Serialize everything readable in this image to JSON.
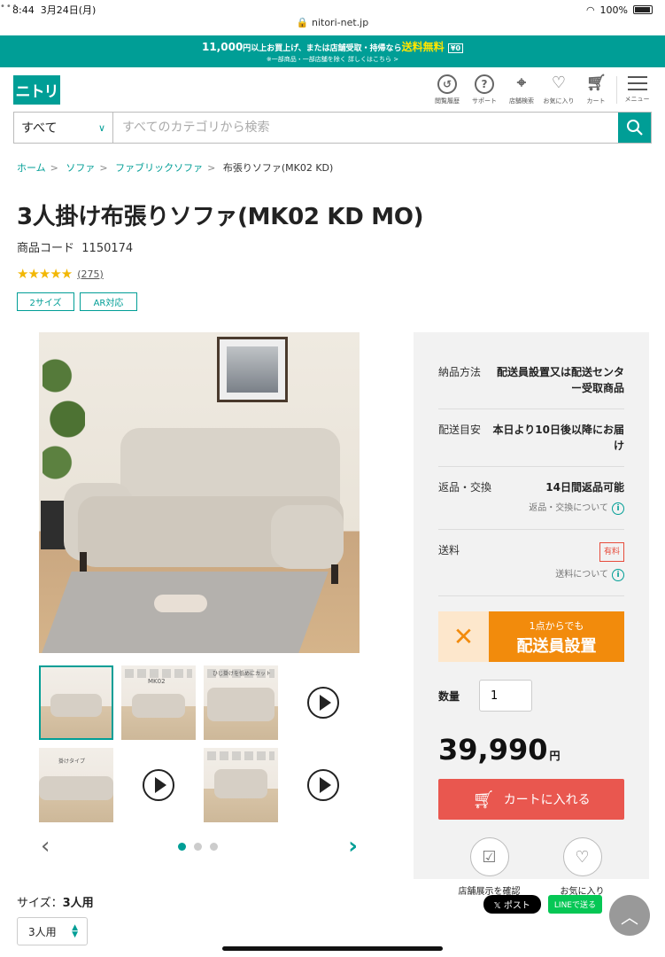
{
  "status": {
    "time": "8:44",
    "date": "3月24日(月)",
    "url": "nitori-net.jp",
    "battery": "100%"
  },
  "banner": {
    "line1_a": "11,000",
    "line1_b": "円以上お買上げ、または店舗受取・持帰なら",
    "line1_c": "送料無料",
    "line2": "※一部商品・一部店舗を除く 詳しくはこちら >"
  },
  "header": {
    "logo": "ニトリ",
    "icons": [
      {
        "label": "閲覧履歴",
        "icon": "history-icon"
      },
      {
        "label": "サポート",
        "icon": "help-icon"
      },
      {
        "label": "店舗検索",
        "icon": "location-pin-icon"
      },
      {
        "label": "お気に入り",
        "icon": "heart-icon",
        "count": "0"
      },
      {
        "label": "カート",
        "icon": "cart-icon",
        "count": "0"
      }
    ],
    "menu_label": "メニュー"
  },
  "search": {
    "category": "すべて",
    "placeholder": "すべてのカテゴリから検索"
  },
  "breadcrumb": [
    "ホーム",
    "ソファ",
    "ファブリックソファ",
    "布張りソファ(MK02 KD)"
  ],
  "product": {
    "title": "3人掛け布張りソファ(MK02 KD MO)",
    "code_label": "商品コード",
    "code": "1150174",
    "stars": "★★★★★",
    "rating_value": 4.5,
    "review_count": "(275)",
    "tags": [
      "2サイズ",
      "AR対応"
    ]
  },
  "panel": {
    "delivery_method_label": "納品方法",
    "delivery_method": "配送員設置又は配送センター受取商品",
    "delivery_date_label": "配送目安",
    "delivery_date": "本日より10日後以降にお届け",
    "returns_label": "返品・交換",
    "returns_value": "14日間返品可能",
    "returns_link": "返品・交換について",
    "shipping_label": "送料",
    "shipping_badge": "有料",
    "shipping_link": "送料について",
    "promo_line1": "1点からでも",
    "promo_line2": "配送員設置",
    "qty_label": "数量",
    "qty_value": "1",
    "price": "39,990",
    "price_unit": "円",
    "cart_button": "カートに入れる",
    "store_display": "店舗展示を確認",
    "favorite": "お気に入り"
  },
  "thumbs": {
    "t2_text": "MK02",
    "t3_text": "ひじ掛けを低めにカット",
    "t5_text": "掛けタイプ"
  },
  "size": {
    "label": "サイズ：",
    "value": "3人用",
    "selected": "3人用"
  },
  "share": {
    "x": "𝕏 ポスト",
    "line": "LINEで送る"
  },
  "colors": {
    "accent": "#009e96",
    "cart": "#e9574f",
    "promo": "#f28b0c",
    "star": "#f2b705"
  }
}
